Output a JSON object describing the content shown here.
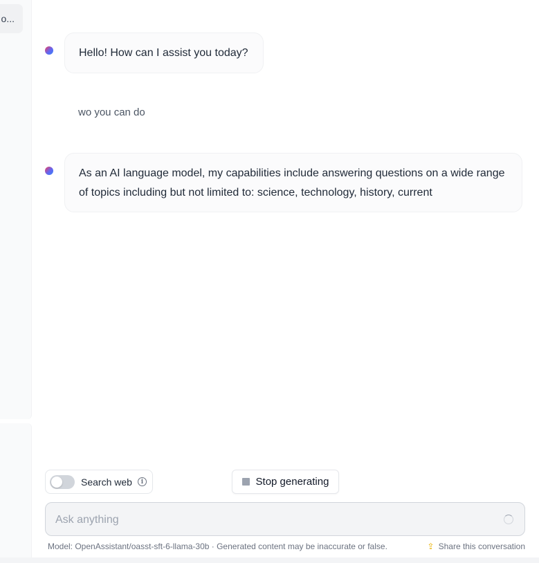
{
  "sidebar": {
    "active_conversation": "o..."
  },
  "messages": [
    {
      "role": "assistant",
      "text": "Hello! How can I assist you today?"
    },
    {
      "role": "user",
      "text": "wo you can do"
    },
    {
      "role": "assistant",
      "text": "As an AI language model, my capabilities include answering questions on a wide range of topics including but not limited to: science, technology, history, current"
    }
  ],
  "controls": {
    "search_web_label": "Search web",
    "search_web_enabled": false,
    "stop_label": "Stop generating"
  },
  "input": {
    "placeholder": "Ask anything",
    "value": ""
  },
  "footer": {
    "model_text": "Model: OpenAssistant/oasst-sft-6-llama-30b · Generated content may be inaccurate or false.",
    "share_label": "Share this conversation"
  },
  "icons": {
    "info": "info-icon",
    "stop": "stop-square-icon",
    "loading": "spinner-icon",
    "share": "share-arrow-icon"
  },
  "colors": {
    "accent_share": "#eab308",
    "bubble_bg": "#fbfbfc",
    "input_bg": "#f3f4f6"
  }
}
